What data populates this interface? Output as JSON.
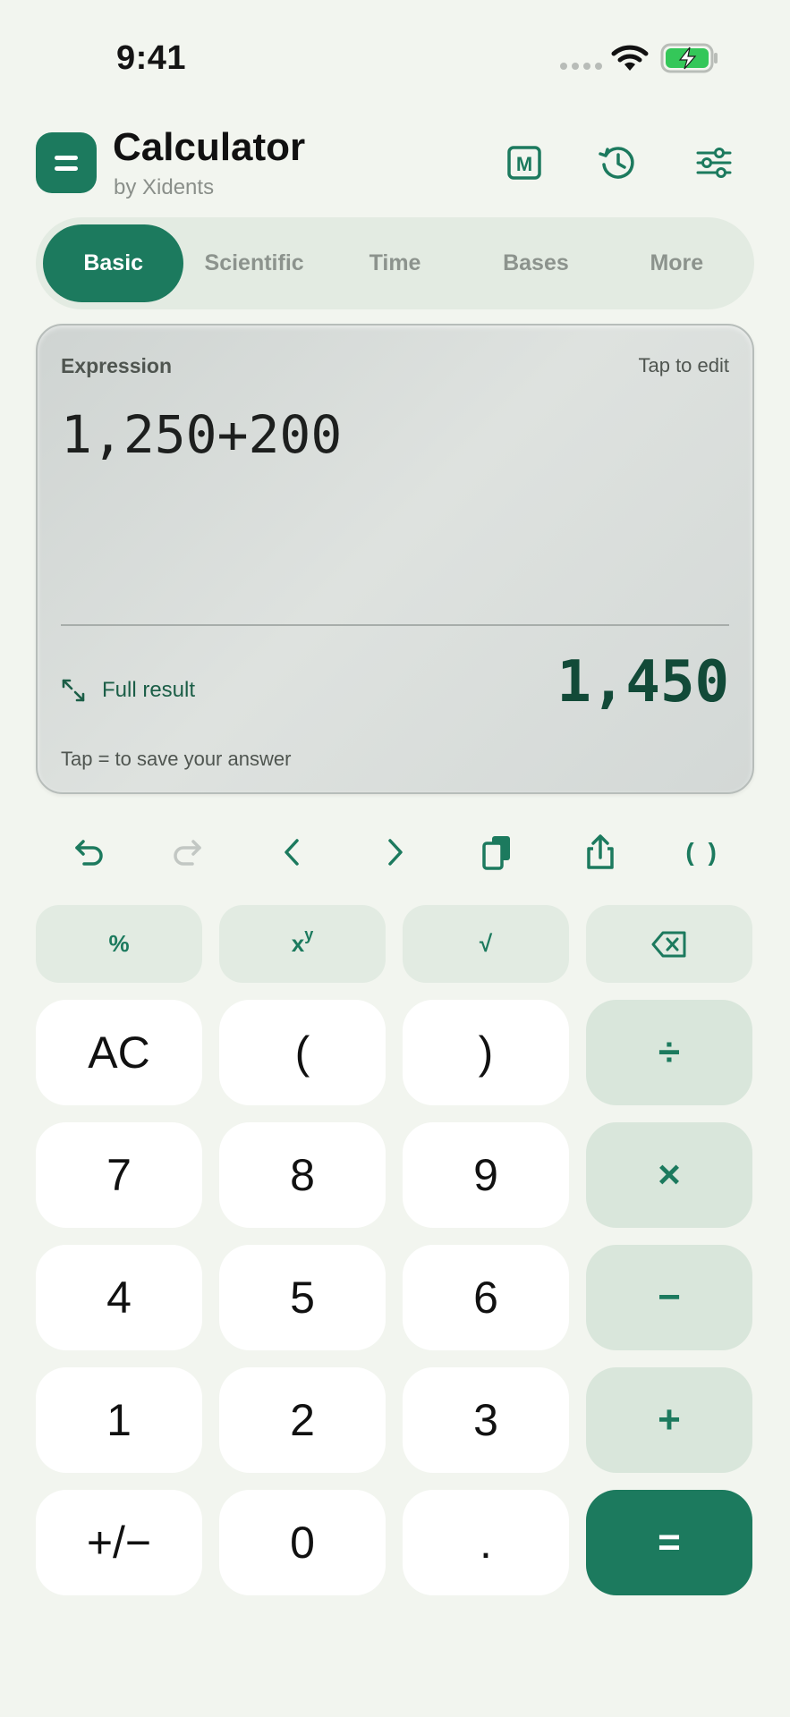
{
  "status_bar": {
    "time": "9:41"
  },
  "header": {
    "title": "Calculator",
    "subtitle": "by Xidents",
    "memory_label": "M"
  },
  "tabs": [
    {
      "label": "Basic",
      "active": true
    },
    {
      "label": "Scientific",
      "active": false
    },
    {
      "label": "Time",
      "active": false
    },
    {
      "label": "Bases",
      "active": false
    },
    {
      "label": "More",
      "active": false
    }
  ],
  "display": {
    "expression_label": "Expression",
    "edit_hint": "Tap to edit",
    "expression": "1,250+200",
    "full_result_label": "Full result",
    "result": "1,450",
    "save_hint": "Tap = to save your answer"
  },
  "toolbar": {
    "parens_label": "( )"
  },
  "keypad": {
    "func_row": {
      "percent": "%",
      "power_base": "x",
      "power_exp": "y",
      "sqrt": "√"
    },
    "rows": [
      [
        "AC",
        "(",
        ")",
        "÷"
      ],
      [
        "7",
        "8",
        "9",
        "×"
      ],
      [
        "4",
        "5",
        "6",
        "−"
      ],
      [
        "1",
        "2",
        "3",
        "+"
      ],
      [
        "+/−",
        "0",
        ".",
        "="
      ]
    ]
  },
  "colors": {
    "accent": "#1c7a5e",
    "background": "#f2f5ef",
    "operator_key": "#d9e6db",
    "function_key": "#e2ebe2"
  }
}
